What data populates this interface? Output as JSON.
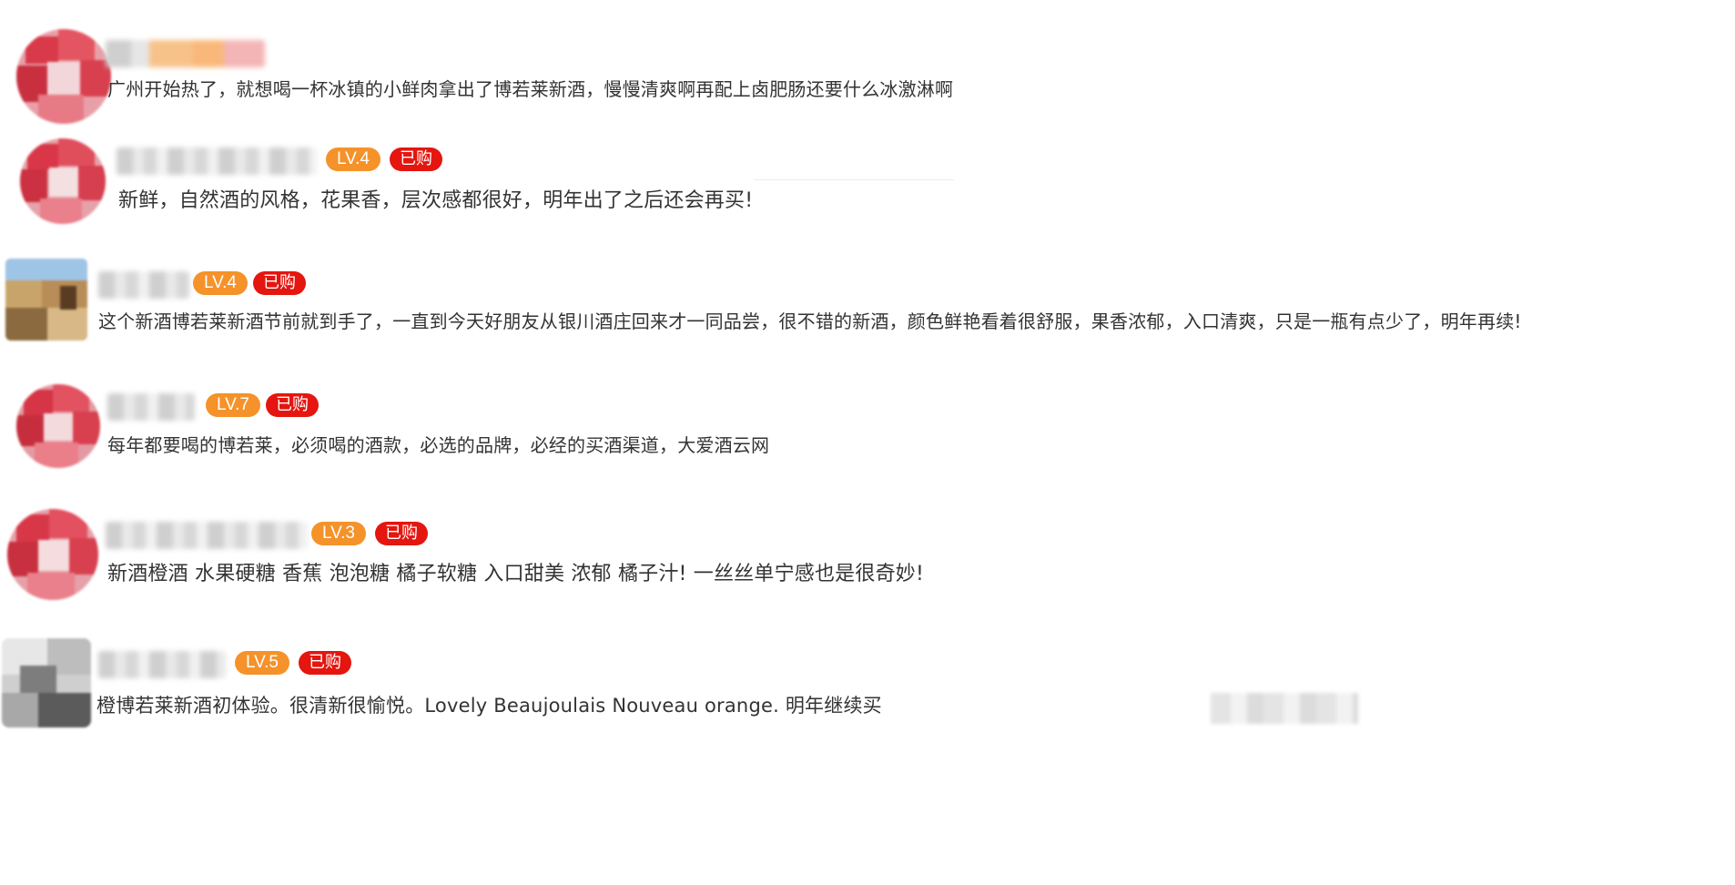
{
  "comments": [
    {
      "text": "广州开始热了，就想喝一杯冰镇的小鲜肉拿出了博若莱新酒，慢慢清爽啊再配上卤肥肠还要什么冰激淋啊"
    },
    {
      "level": "LV.4",
      "purchased": "已购",
      "text": "新鲜，自然酒的风格，花果香，层次感都很好，明年出了之后还会再买!"
    },
    {
      "level": "LV.4",
      "purchased": "已购",
      "text": "这个新酒博若莱新酒节前就到手了，一直到今天好朋友从银川酒庄回来才一同品尝，很不错的新酒，颜色鲜艳看着很舒服，果香浓郁，入口清爽，只是一瓶有点少了，明年再续!"
    },
    {
      "level": "LV.7",
      "purchased": "已购",
      "text": "每年都要喝的博若莱，必须喝的酒款，必选的品牌，必经的买酒渠道，大爱酒云网"
    },
    {
      "level": "LV.3",
      "purchased": "已购",
      "text": "新酒橙酒 水果硬糖 香蕉 泡泡糖 橘子软糖 入口甜美 浓郁 橘子汁!  一丝丝单宁感也是很奇妙!"
    },
    {
      "level": "LV.5",
      "purchased": "已购",
      "text": "橙博若莱新酒初体验。很清新很愉悦。Lovely Beaujoulais Nouveau orange. 明年继续买"
    }
  ],
  "colors": {
    "level_badge": "#f5922a",
    "purchased_badge": "#e4160f",
    "text": "#333333"
  }
}
